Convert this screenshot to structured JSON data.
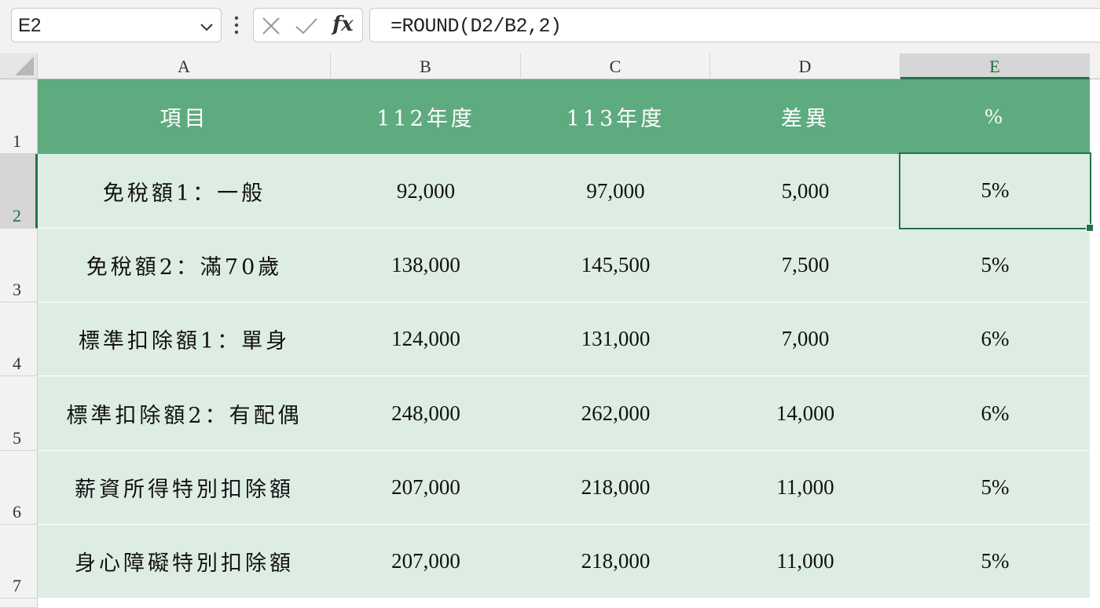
{
  "name_box": "E2",
  "formula": "=ROUND(D2/B2,2)",
  "fx_label": "fx",
  "columns": [
    "A",
    "B",
    "C",
    "D",
    "E"
  ],
  "selected_column": "E",
  "selected_row": "2",
  "colors": {
    "header_fill": "#5eab7f",
    "body_fill": "#deede4",
    "selection": "#217346"
  },
  "rows": [
    {
      "num": "1",
      "cells": [
        "項目",
        "112年度",
        "113年度",
        "差異",
        "%"
      ]
    },
    {
      "num": "2",
      "cells": [
        "免稅額1：一般",
        "92,000",
        "97,000",
        "5,000",
        "5%"
      ]
    },
    {
      "num": "3",
      "cells": [
        "免稅額2：滿70歲",
        "138,000",
        "145,500",
        "7,500",
        "5%"
      ]
    },
    {
      "num": "4",
      "cells": [
        "標準扣除額1：單身",
        "124,000",
        "131,000",
        "7,000",
        "6%"
      ]
    },
    {
      "num": "5",
      "cells": [
        "標準扣除額2：有配偶",
        "248,000",
        "262,000",
        "14,000",
        "6%"
      ]
    },
    {
      "num": "6",
      "cells": [
        "薪資所得特別扣除額",
        "207,000",
        "218,000",
        "11,000",
        "5%"
      ]
    },
    {
      "num": "7",
      "cells": [
        "身心障礙特別扣除額",
        "207,000",
        "218,000",
        "11,000",
        "5%"
      ]
    }
  ]
}
